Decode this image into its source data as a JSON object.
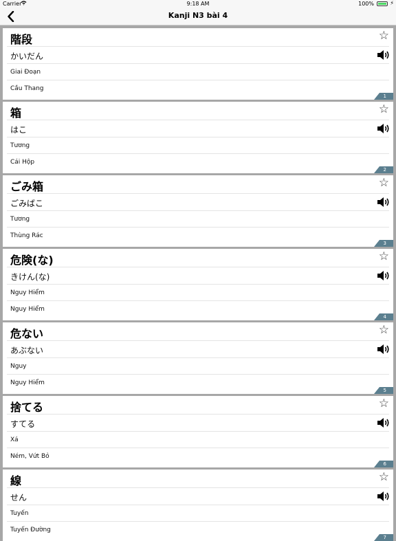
{
  "status": {
    "carrier": "Carrier",
    "time": "9:18 AM",
    "battery": "100%"
  },
  "nav": {
    "title": "Kanji N3 bài 4"
  },
  "items": [
    {
      "kanji": "階段",
      "reading": "かいだん",
      "hanviet": "Giai Đoạn",
      "meaning": "Cầu Thang",
      "number": "1"
    },
    {
      "kanji": "箱",
      "reading": "はこ",
      "hanviet": "Tương",
      "meaning": "Cái Hộp",
      "number": "2"
    },
    {
      "kanji": "ごみ箱",
      "reading": "ごみばこ",
      "hanviet": "Tương",
      "meaning": "Thùng Rác",
      "number": "3"
    },
    {
      "kanji": "危険(な)",
      "reading": "きけん(な)",
      "hanviet": "Nguy Hiểm",
      "meaning": "Nguy Hiểm",
      "number": "4"
    },
    {
      "kanji": "危ない",
      "reading": "あぶない",
      "hanviet": "Nguy",
      "meaning": "Nguy Hiểm",
      "number": "5"
    },
    {
      "kanji": "捨てる",
      "reading": "すてる",
      "hanviet": "Xá",
      "meaning": "Ném, Vứt Bỏ",
      "number": "6"
    },
    {
      "kanji": "線",
      "reading": "せん",
      "hanviet": "Tuyến",
      "meaning": "Tuyến Đường",
      "number": "7"
    }
  ]
}
